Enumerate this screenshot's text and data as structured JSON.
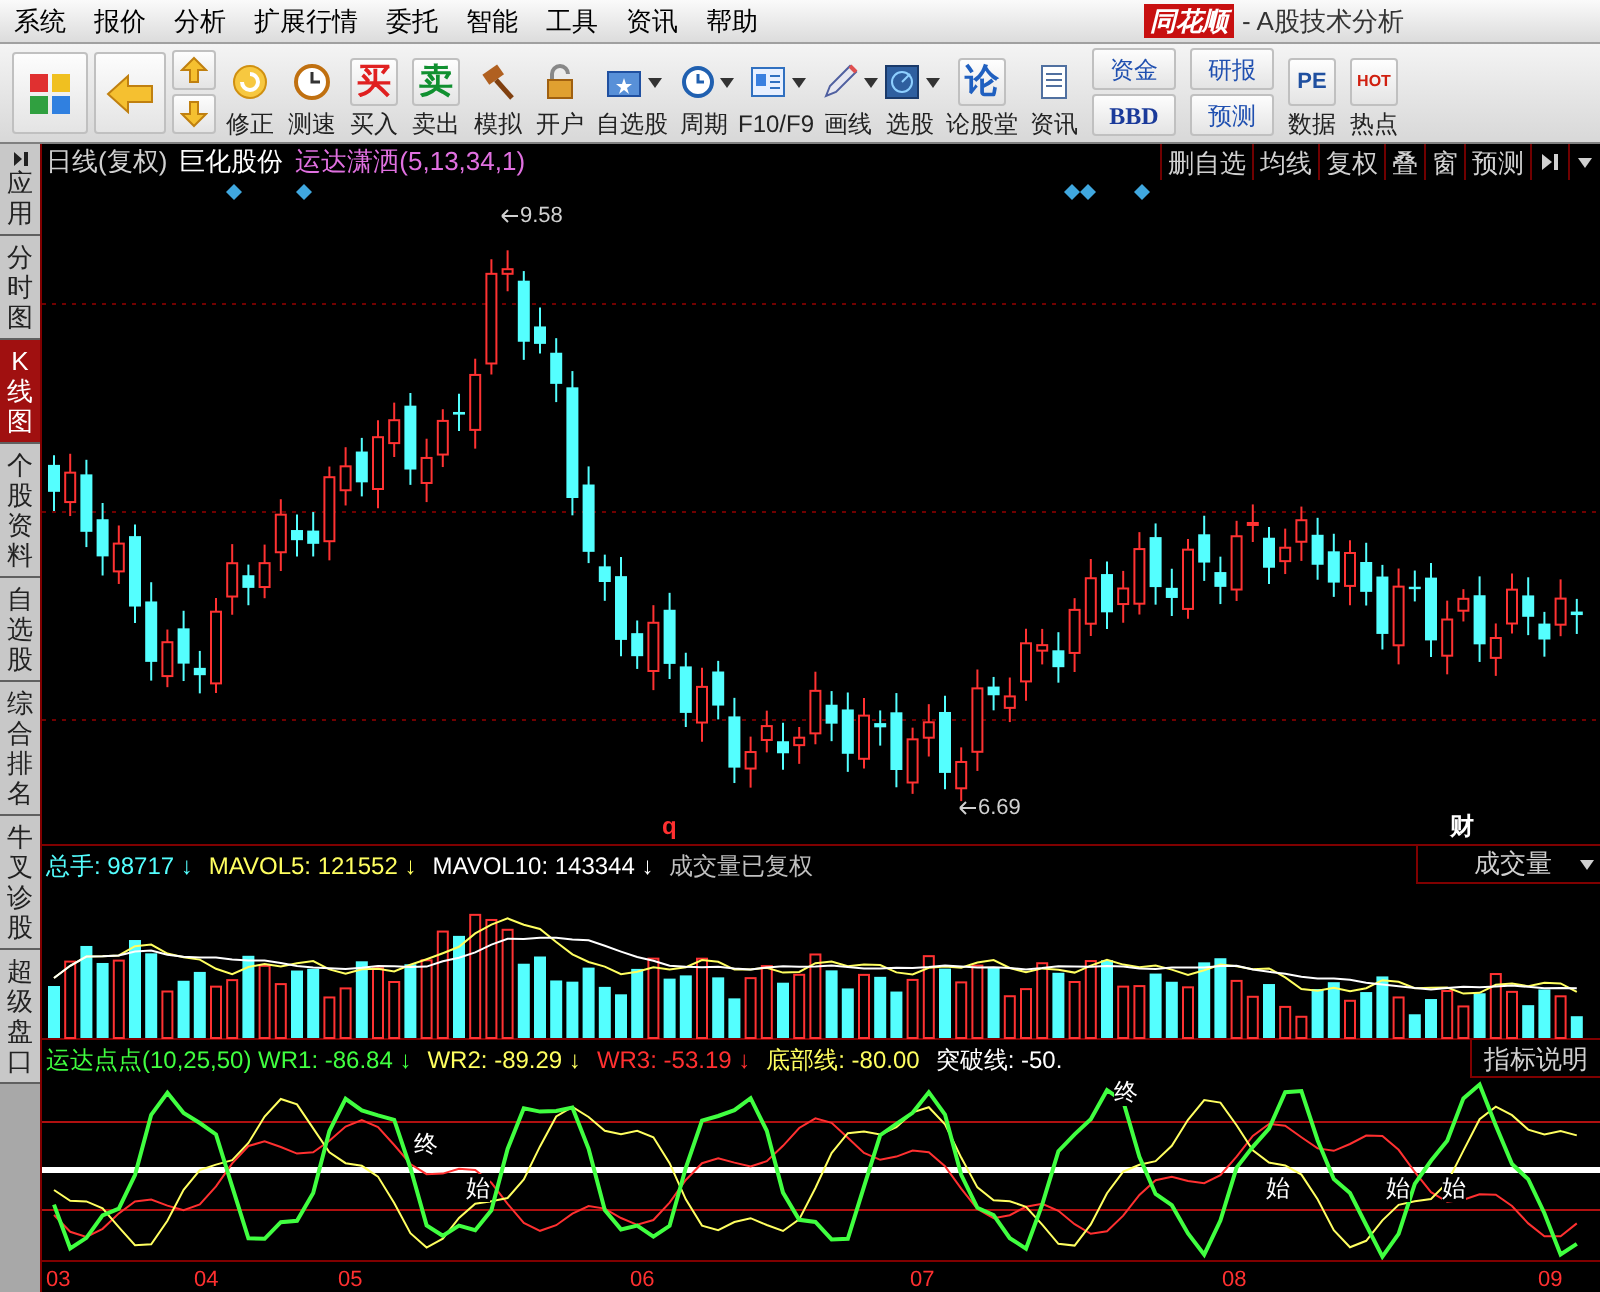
{
  "menu": [
    "系统",
    "报价",
    "分析",
    "扩展行情",
    "委托",
    "智能",
    "工具",
    "资讯",
    "帮助"
  ],
  "title": {
    "logo": "同花顺",
    "text": "- A股技术分析"
  },
  "toolbar": [
    {
      "kind": "icon",
      "label": "修正",
      "dropdown": false
    },
    {
      "kind": "icon",
      "label": "测速",
      "dropdown": false
    },
    {
      "kind": "glyph",
      "glyph": "买",
      "color": "#e02020",
      "label": "买入",
      "dropdown": false
    },
    {
      "kind": "glyph",
      "glyph": "卖",
      "color": "#109030",
      "label": "卖出",
      "dropdown": false
    },
    {
      "kind": "icon",
      "label": "模拟",
      "dropdown": false
    },
    {
      "kind": "icon",
      "label": "开户",
      "dropdown": false
    },
    {
      "kind": "icon",
      "label": "自选股",
      "dropdown": true
    },
    {
      "kind": "icon",
      "label": "周期",
      "dropdown": true
    },
    {
      "kind": "icon",
      "label": "F10/F9",
      "dropdown": true
    },
    {
      "kind": "icon",
      "label": "画线",
      "dropdown": true
    },
    {
      "kind": "icon",
      "label": "选股",
      "dropdown": true
    },
    {
      "kind": "glyph",
      "glyph": "论",
      "color": "#2060c0",
      "label": "论股堂",
      "dropdown": false
    },
    {
      "kind": "icon",
      "label": "资讯",
      "dropdown": false
    },
    {
      "kind": "pair",
      "labels": [
        "资金",
        "BBD"
      ]
    },
    {
      "kind": "pair",
      "labels": [
        "研报",
        "预测"
      ]
    },
    {
      "kind": "glyph",
      "glyph": "PE",
      "color": "#2050a0",
      "label": "数据",
      "dropdown": false
    },
    {
      "kind": "glyph",
      "glyph": "HOT",
      "color": "#d02010",
      "label": "热点",
      "dropdown": false
    }
  ],
  "sidebar": [
    {
      "label": "应用",
      "selected": false
    },
    {
      "label": "分时图",
      "selected": false
    },
    {
      "label": "K线图",
      "selected": true
    },
    {
      "label": "个股资料",
      "selected": false
    },
    {
      "label": "自选股",
      "selected": false
    },
    {
      "label": "综合排名",
      "selected": false
    },
    {
      "label": "牛叉诊股",
      "selected": false
    },
    {
      "label": "超级盘口",
      "selected": false
    }
  ],
  "chart": {
    "period": "日线(复权)",
    "stock": "巨化股份",
    "indicator": "运达潇洒(5,13,34,1)",
    "tools": [
      "删自选",
      "均线",
      "复权",
      "叠",
      "窗",
      "预测"
    ],
    "high_label": "9.58",
    "low_label": "6.69",
    "markers": [
      {
        "text": "q",
        "color": "#ff3030"
      },
      {
        "text": "财",
        "color": "#ffffff"
      }
    ]
  },
  "volume": {
    "legend": [
      {
        "text": "总手: 98717 ↓",
        "color": "#54ffff"
      },
      {
        "text": "MAVOL5: 121552 ↓",
        "color": "#ffff60"
      },
      {
        "text": "MAVOL10: 143344 ↓",
        "color": "#ffffff"
      },
      {
        "text": "成交量已复权",
        "color": "#c0c0c0"
      }
    ],
    "selector": "成交量"
  },
  "indicator": {
    "legend": [
      {
        "text": "运达点点(10,25,50) WR1: -86.84 ↓",
        "color": "#40ff40"
      },
      {
        "text": "WR2: -89.29 ↓",
        "color": "#ffff60"
      },
      {
        "text": "WR3: -53.19 ↓",
        "color": "#ff3030"
      },
      {
        "text": "底部线: -80.00",
        "color": "#ffff60"
      },
      {
        "text": "突破线: -50.",
        "color": "#ffffff"
      }
    ],
    "button": "指标说明",
    "signals": [
      "终",
      "始",
      "终",
      "始",
      "始",
      "始"
    ]
  },
  "x_axis": [
    "03",
    "04",
    "05",
    "06",
    "07",
    "08",
    "09"
  ]
}
